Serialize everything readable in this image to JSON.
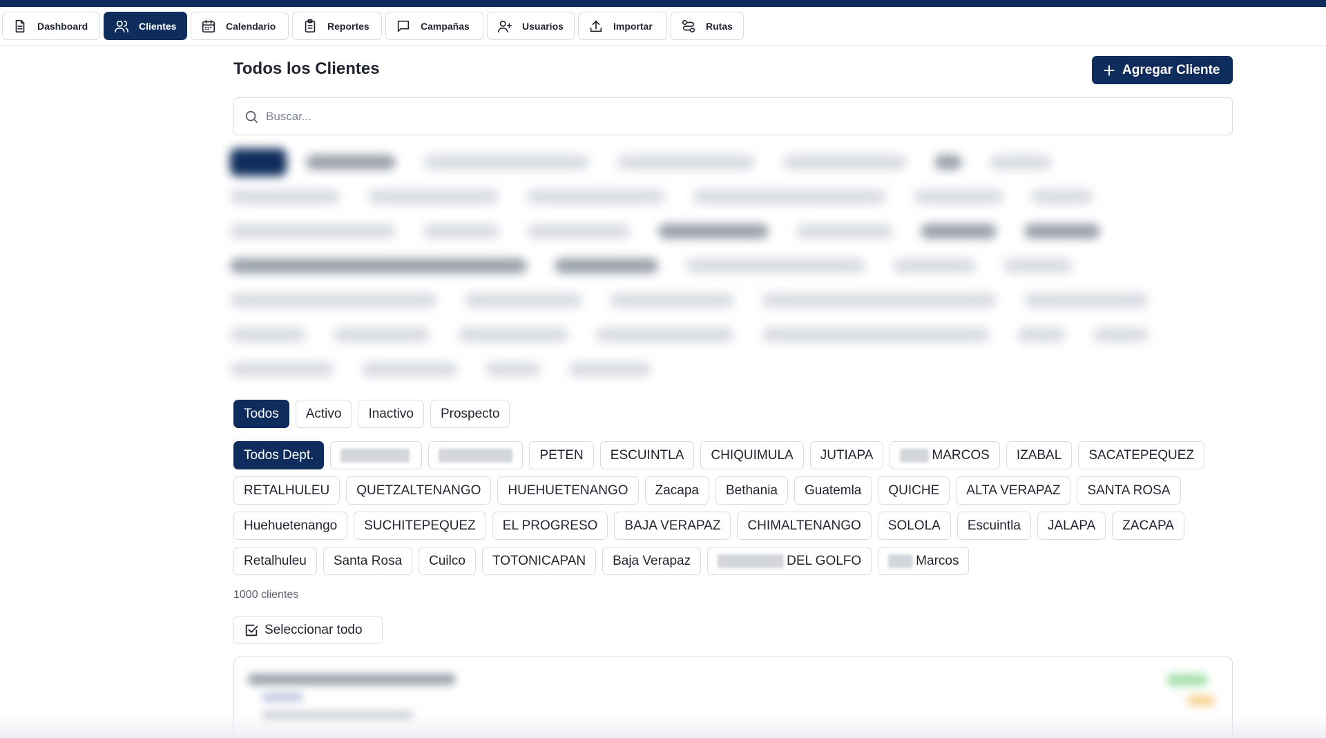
{
  "nav": {
    "tabs": [
      {
        "label": "Dashboard",
        "icon": "document-icon",
        "active": false
      },
      {
        "label": "Clientes",
        "icon": "users-icon",
        "active": true
      },
      {
        "label": "Calendario",
        "icon": "calendar-icon",
        "active": false
      },
      {
        "label": "Reportes",
        "icon": "clipboard-icon",
        "active": false
      },
      {
        "label": "Campañas",
        "icon": "message-icon",
        "active": false
      },
      {
        "label": "Usuarios",
        "icon": "user-plus-icon",
        "active": false
      },
      {
        "label": "Importar",
        "icon": "upload-icon",
        "active": false
      },
      {
        "label": "Rutas",
        "icon": "route-icon",
        "active": false
      }
    ]
  },
  "header": {
    "title": "Todos los Clientes",
    "add_label": "Agregar Cliente"
  },
  "search": {
    "placeholder": "Buscar...",
    "value": ""
  },
  "status_filters": [
    {
      "label": "Todos",
      "active": true
    },
    {
      "label": "Activo",
      "active": false
    },
    {
      "label": "Inactivo",
      "active": false
    },
    {
      "label": "Prospecto",
      "active": false
    }
  ],
  "department_filters": {
    "all_label": "Todos Dept.",
    "rows": [
      [
        "PETEN",
        "ESCUINTLA",
        "CHIQUIMULA",
        "JUTIAPA",
        "MARCOS",
        "IZABAL",
        "SACATEPEQUEZ"
      ],
      [
        "RETALHULEU",
        "QUETZALTENANGO",
        "HUEHUETENANGO",
        "Zacapa",
        "Bethania",
        "Guatemla",
        "QUICHE",
        "ALTA VERAPAZ",
        "SANTA ROSA"
      ],
      [
        "Huehuetenango",
        "SUCHITEPEQUEZ",
        "EL PROGRESO",
        "BAJA VERAPAZ",
        "CHIMALTENANGO",
        "SOLOLA",
        "Escuintla",
        "JALAPA",
        "ZACAPA"
      ],
      [
        "Retalhuleu",
        "Santa Rosa",
        "Cuilco",
        "TOTONICAPAN",
        "Baja Verapaz",
        "DEL GOLFO",
        "Marcos"
      ]
    ]
  },
  "results": {
    "count_text": "1000 clientes",
    "select_all_label": "Seleccionar todo"
  },
  "colors": {
    "brand": "#0f2d5c",
    "border": "#d9dde3"
  }
}
